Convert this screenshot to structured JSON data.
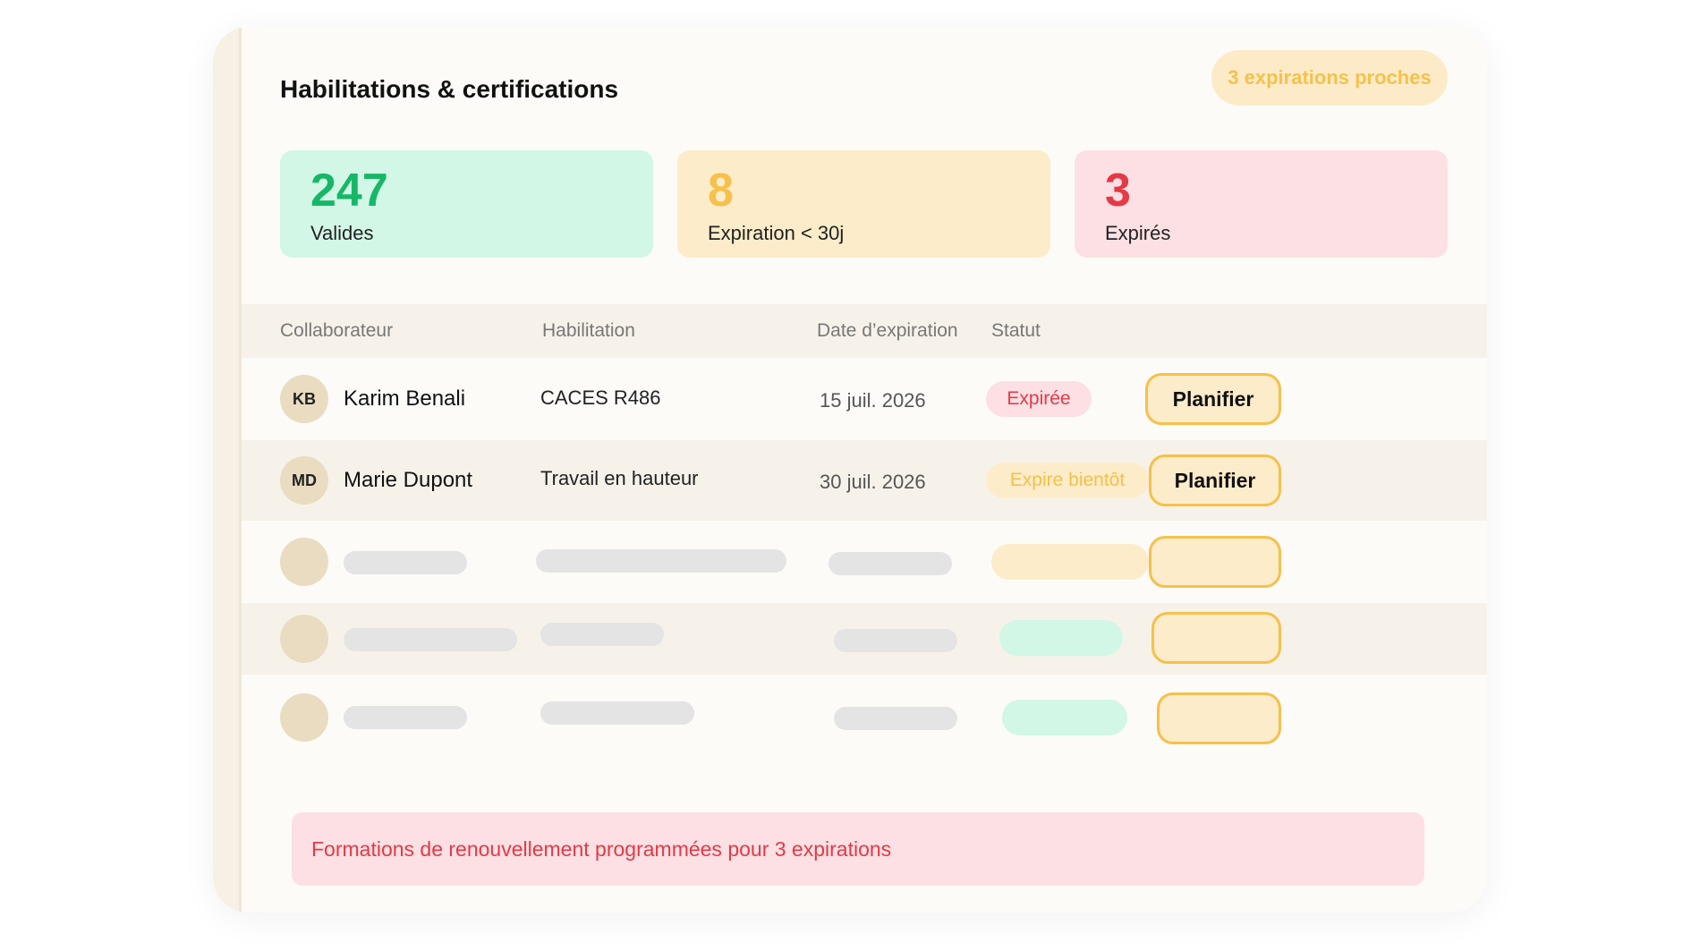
{
  "header": {
    "title": "Habilitations & certifications",
    "badge": "3 expirations proches"
  },
  "stats": [
    {
      "value": "247",
      "label": "Valides"
    },
    {
      "value": "8",
      "label": "Expiration < 30j"
    },
    {
      "value": "3",
      "label": "Expirés"
    }
  ],
  "table": {
    "columns": [
      "Collaborateur",
      "Habilitation",
      "Date d’expiration",
      "Statut"
    ],
    "rows": [
      {
        "initials": "KB",
        "name": "Karim Benali",
        "habilitation": "CACES R486",
        "date": "15 juil. 2026",
        "status": "Expirée",
        "action": "Planifier"
      },
      {
        "initials": "MD",
        "name": "Marie Dupont",
        "habilitation": "Travail en hauteur",
        "date": "30 juil. 2026",
        "status": "Expire bientôt",
        "action": "Planifier"
      }
    ]
  },
  "footer": {
    "note": "Formations de renouvellement programmées pour 3 expirations"
  },
  "colors": {
    "green": "#16b868",
    "orange": "#f6c04a",
    "red": "#e53947",
    "cream": "#f7f2e9"
  }
}
